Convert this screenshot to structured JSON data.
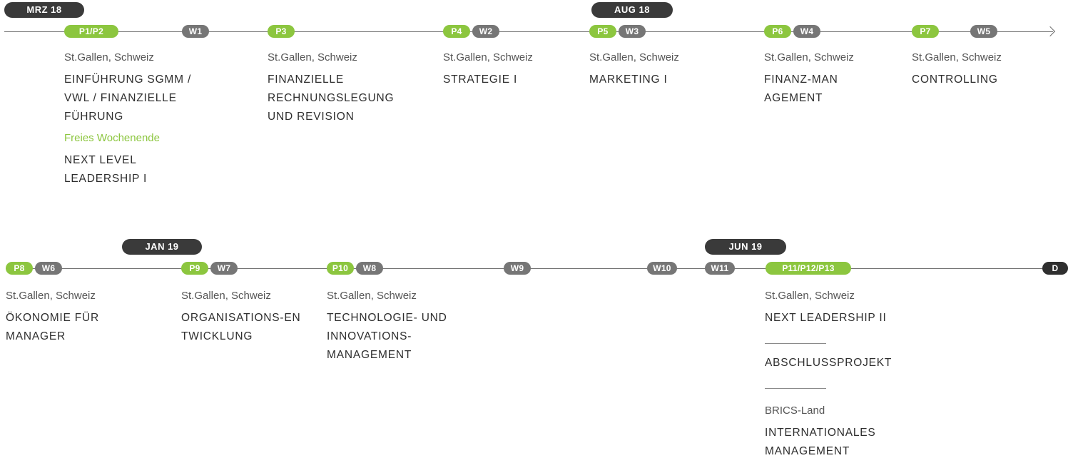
{
  "dates": {
    "mrz18": "MRZ 18",
    "aug18": "AUG 18",
    "jan19": "JAN 19",
    "jun19": "JUN 19"
  },
  "badges": {
    "p1p2": "P1/P2",
    "w1": "W1",
    "p3": "P3",
    "p4": "P4",
    "w2": "W2",
    "p5": "P5",
    "w3": "W3",
    "p6": "P6",
    "w4": "W4",
    "p7": "P7",
    "w5": "W5",
    "p8": "P8",
    "w6": "W6",
    "p9": "P9",
    "w7": "W7",
    "p10": "P10",
    "w8": "W8",
    "w9": "W9",
    "w10": "W10",
    "w11": "W11",
    "p11": "P11/P12/P13",
    "d": "D"
  },
  "modules": {
    "m1": {
      "location": "St.Gallen, Schweiz",
      "title": "EINFÜHRUNG SGMM / VWL / FINANZIELLE FÜHRUNG",
      "note": "Freies Wochenende",
      "title2": "NEXT LEVEL LEADERSHIP I"
    },
    "m2": {
      "location": "St.Gallen, Schweiz",
      "title": "FINANZIELLE RECHNUNGSLEGUNG UND REVISION"
    },
    "m3": {
      "location": "St.Gallen, Schweiz",
      "title": "STRATEGIE I"
    },
    "m4": {
      "location": "St.Gallen, Schweiz",
      "title": "MARKETING I"
    },
    "m5": {
      "location": "St.Gallen, Schweiz",
      "title": "FINANZ-MANAGEMENT"
    },
    "m6": {
      "location": "St.Gallen, Schweiz",
      "title": "CONTROLLING"
    },
    "m7": {
      "location": "St.Gallen, Schweiz",
      "title": "ÖKONOMIE FÜR MANAGER"
    },
    "m8": {
      "location": "St.Gallen, Schweiz",
      "title": "ORGANISATIONS-ENTWICKLUNG"
    },
    "m9": {
      "location": "St.Gallen, Schweiz",
      "title": "TECHNOLOGIE- UND INNOVATIONS-MANAGEMENT"
    },
    "m10": {
      "location": "St.Gallen, Schweiz",
      "title": "NEXT LEADERSHIP II",
      "title2": "ABSCHLUSSPROJEKT",
      "location2": "BRICS-Land",
      "title3": "INTERNATIONALES MANAGEMENT"
    }
  }
}
